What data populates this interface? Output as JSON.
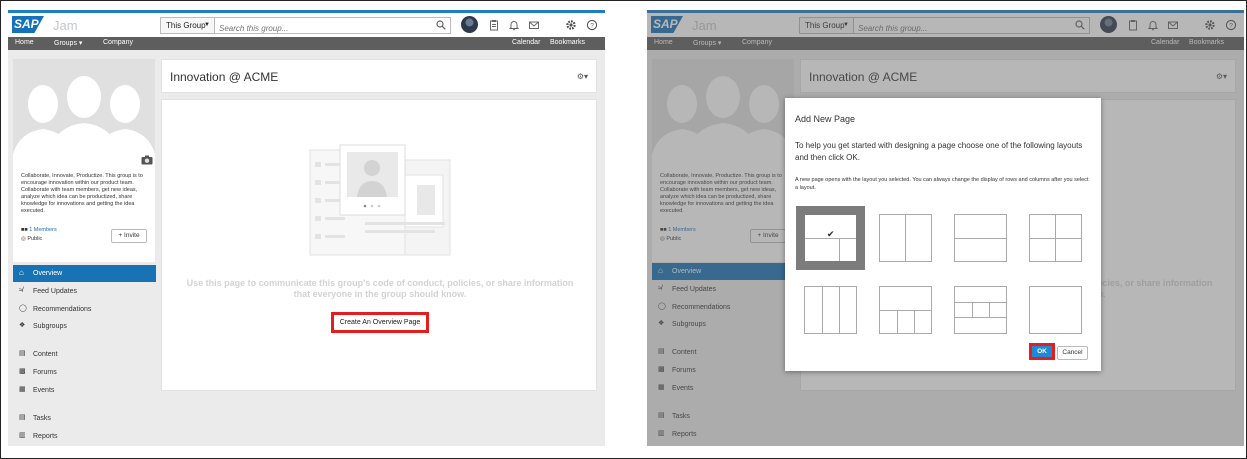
{
  "app": {
    "logo": "SAP",
    "name": "Jam"
  },
  "search": {
    "scope": "This Group",
    "placeholder": "Search this group..."
  },
  "nav": {
    "home": "Home",
    "groups": "Groups",
    "company": "Company",
    "calendar": "Calendar",
    "bookmarks": "Bookmarks"
  },
  "group": {
    "title": "Innovation @ ACME",
    "description": "Collaborate, Innovate, Productize. This group is to encourage innovation within our product team. Collaborate with team members, get new ideas, analyze which idea can be productized, share knowledge for innovations and getting the idea executed.",
    "members": "1 Members",
    "visibility": "Public",
    "invite": "Invite"
  },
  "sidebar": {
    "items": [
      {
        "label": "Overview",
        "icon": "home-icon"
      },
      {
        "label": "Feed Updates",
        "icon": "rss-icon"
      },
      {
        "label": "Recommendations",
        "icon": "lightbulb-icon"
      },
      {
        "label": "Subgroups",
        "icon": "subgroups-icon"
      },
      {
        "label": "Content",
        "icon": "document-icon"
      },
      {
        "label": "Forums",
        "icon": "chat-icon"
      },
      {
        "label": "Events",
        "icon": "calendar-icon"
      },
      {
        "label": "Tasks",
        "icon": "clipboard-icon"
      },
      {
        "label": "Reports",
        "icon": "chart-icon"
      }
    ]
  },
  "overview": {
    "hint": "Use this page to communicate this group's code of conduct, policies, or share information that everyone in the group should know.",
    "create_button": "Create An Overview Page"
  },
  "dialog": {
    "title": "Add New Page",
    "instructions": "To help you get started with designing a page choose one of the following layouts and then click OK.",
    "note": "A new page opens with the layout you selected. You can always change the display of rows and columns after you select a layout.",
    "selected_mark": "✔",
    "ok": "OK",
    "cancel": "Cancel"
  },
  "colors": {
    "accent": "#1773b4",
    "highlight": "#e41e1e",
    "navbar": "#5e5e5e"
  }
}
